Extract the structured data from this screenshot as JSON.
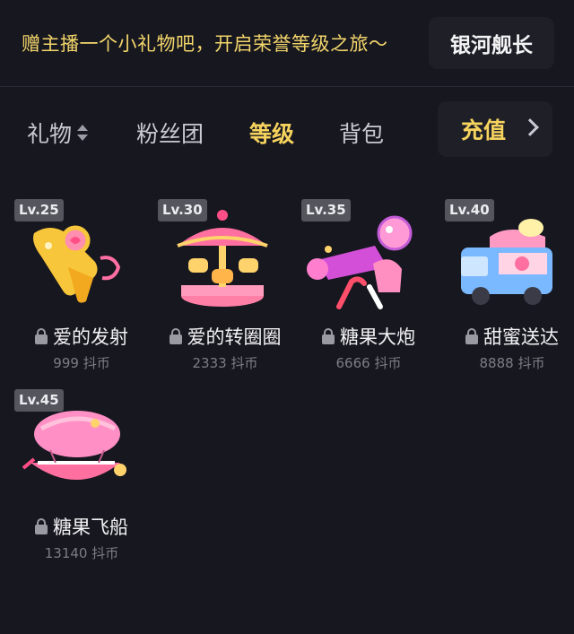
{
  "banner": {
    "text": "赠主播一个小礼物吧，开启荣誉等级之旅～",
    "rank_button": "银河舰长"
  },
  "tabs": [
    {
      "label": "礼物",
      "active": false
    },
    {
      "label": "粉丝团",
      "active": false
    },
    {
      "label": "等级",
      "active": true
    },
    {
      "label": "背包",
      "active": false
    }
  ],
  "recharge": {
    "label": "充值",
    "icon": "chevron-right-icon"
  },
  "gifts": [
    {
      "level": "Lv.25",
      "name": "爱的发射",
      "price": "999 抖币",
      "locked": true
    },
    {
      "level": "Lv.30",
      "name": "爱的转圈圈",
      "price": "2333 抖币",
      "locked": true
    },
    {
      "level": "Lv.35",
      "name": "糖果大炮",
      "price": "6666 抖币",
      "locked": true
    },
    {
      "level": "Lv.40",
      "name": "甜蜜送达",
      "price": "8888 抖币",
      "locked": true
    },
    {
      "level": "Lv.45",
      "name": "糖果飞船",
      "price": "13140 抖币",
      "locked": true
    }
  ],
  "colors": {
    "background": "#17171f",
    "accent": "#f6d35e",
    "banner_text": "#f3d66b",
    "level_badge": "#55555d"
  }
}
